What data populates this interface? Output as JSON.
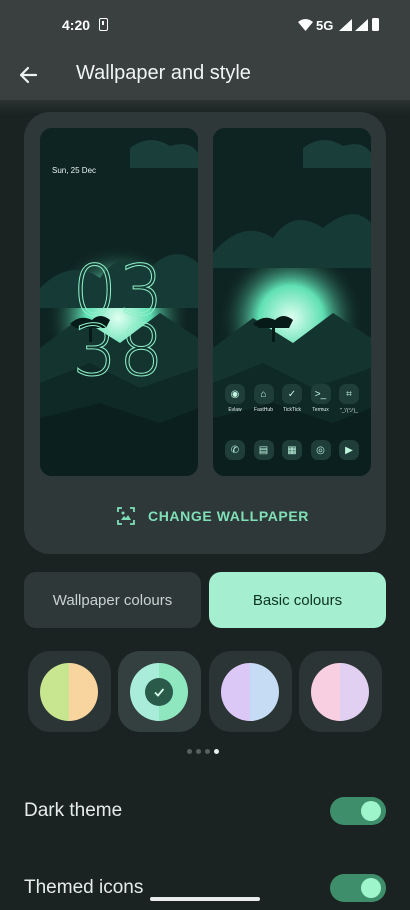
{
  "status_bar": {
    "time": "4:20",
    "network": "5G"
  },
  "app_bar": {
    "title": "Wallpaper and style",
    "back_icon": "arrow-back-icon"
  },
  "preview": {
    "lock_date": "Sun, 25 Dec",
    "clock_hours": "03",
    "clock_minutes": "38",
    "apps_row1": [
      {
        "label": "Evlaw",
        "icon": "eye-icon"
      },
      {
        "label": "FastHub",
        "icon": "robot-icon"
      },
      {
        "label": "TickTick",
        "icon": "check-circle-icon"
      },
      {
        "label": "Termux",
        "icon": "terminal-icon"
      },
      {
        "label": "\"_\\'(ツ)_",
        "icon": "focus-icon"
      }
    ],
    "apps_row2": [
      {
        "icon": "phone-icon"
      },
      {
        "icon": "messages-icon"
      },
      {
        "icon": "gallery-icon"
      },
      {
        "icon": "chrome-icon"
      },
      {
        "icon": "youtube-icon"
      }
    ],
    "change_wallpaper_label": "CHANGE WALLPAPER"
  },
  "color_tabs": {
    "wallpaper_colours": "Wallpaper colours",
    "basic_colours": "Basic colours",
    "selected": "basic_colours"
  },
  "swatches": [
    {
      "left": "#c7e68f",
      "right": "#f8d49e",
      "selected": false
    },
    {
      "left": "#a9ecd9",
      "right": "#8fe7bf",
      "selected": true
    },
    {
      "left": "#dcc8f6",
      "right": "#c6dcf4",
      "selected": false
    },
    {
      "left": "#f8cfe1",
      "right": "#e2d0f2",
      "selected": false
    }
  ],
  "pager": {
    "count": 4,
    "active_index": 3
  },
  "settings": {
    "dark_theme_label": "Dark theme",
    "dark_theme_on": true,
    "themed_icons_label": "Themed icons",
    "themed_icons_on": true
  },
  "colors": {
    "accent": "#7fe0b8",
    "selected_tab": "#a5eed0",
    "toggle_track": "#3e8e6b",
    "background": "#1b2322"
  }
}
